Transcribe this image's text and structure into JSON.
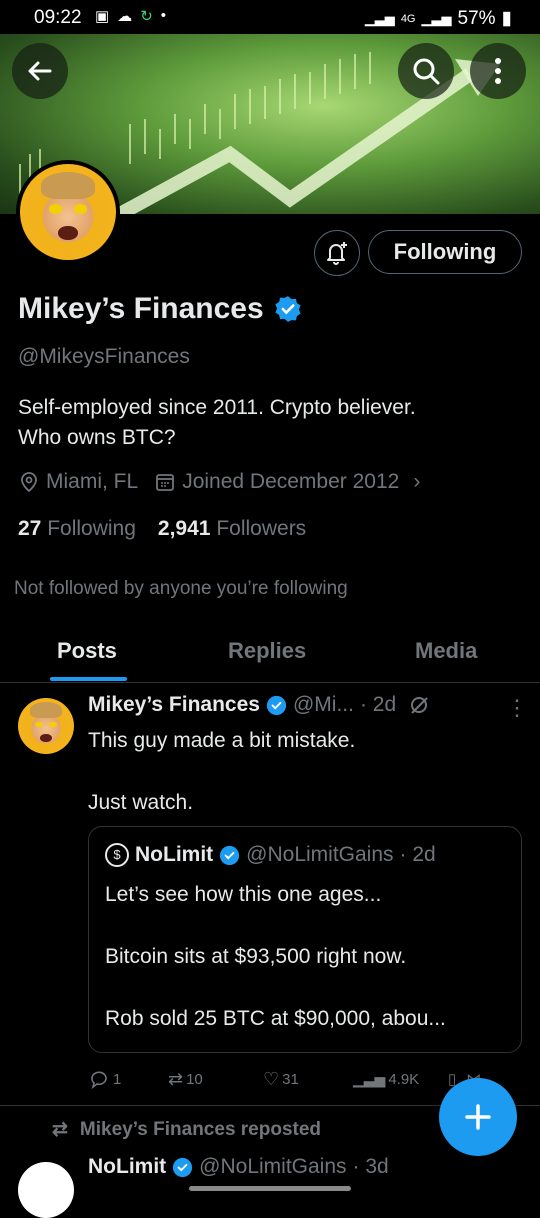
{
  "status_bar": {
    "time": "09:22",
    "network": "4G",
    "battery": "57%"
  },
  "header": {
    "back_icon": "arrow-left-icon",
    "search_icon": "search-icon",
    "more_icon": "more-vertical-icon"
  },
  "profile": {
    "name": "Mikey’s Finances",
    "handle": "@MikeysFinances",
    "bio": "Self-employed since 2011. Crypto believer.\nWho owns BTC?",
    "location": "Miami, FL",
    "joined": "Joined December 2012",
    "following_count": "27",
    "following_label": "Following",
    "followers_count": "2,941",
    "followers_label": "Followers",
    "not_followed": "Not followed by anyone you’re following",
    "follow_button": "Following"
  },
  "tabs": [
    {
      "label": "Posts",
      "active": true
    },
    {
      "label": "Replies",
      "active": false
    },
    {
      "label": "Media",
      "active": false
    }
  ],
  "tweet": {
    "name": "Mikey’s Finances",
    "handle": "@Mi...",
    "time": "· 2d",
    "text": "This guy made a bit mistake.\n\nJust watch.",
    "quote": {
      "name": "NoLimit",
      "handle": "@NoLimitGains",
      "time": "· 2d",
      "text": "Let’s see how this one ages...\n\nBitcoin sits at $93,500 right now.\n\nRob sold 25 BTC at $90,000, abou..."
    },
    "actions": {
      "replies": "1",
      "reposts": "10",
      "likes": "31",
      "views": "4.9K"
    }
  },
  "repost": {
    "label": "Mikey’s Finances reposted",
    "name": "NoLimit",
    "handle": "@NoLimitGains",
    "time": "· 3d"
  },
  "colors": {
    "accent": "#1d9bf0",
    "background": "#000000",
    "muted": "#71767b"
  }
}
